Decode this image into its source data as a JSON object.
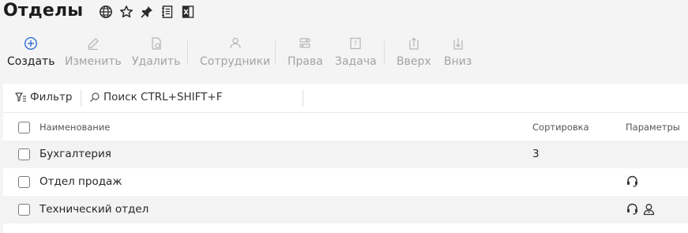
{
  "page": {
    "title": "Отделы",
    "title_icons": [
      "globe-icon",
      "star-icon",
      "pin-icon",
      "notebook-icon",
      "excel-icon"
    ]
  },
  "toolbar": {
    "buttons": [
      {
        "label": "Создать",
        "icon": "plus-circle-icon",
        "enabled": true
      },
      {
        "label": "Изменить",
        "icon": "pencil-icon",
        "enabled": false
      },
      {
        "label": "Удалить",
        "icon": "delete-doc-icon",
        "enabled": false
      },
      {
        "label": "Сотрудники",
        "icon": "employees-icon",
        "enabled": false
      },
      {
        "label": "Права",
        "icon": "rights-icon",
        "enabled": false
      },
      {
        "label": "Задача",
        "icon": "task-icon",
        "enabled": false
      },
      {
        "label": "Вверх",
        "icon": "move-up-icon",
        "enabled": false
      },
      {
        "label": "Вниз",
        "icon": "move-down-icon",
        "enabled": false
      }
    ]
  },
  "filter": {
    "filter_label": "Фильтр",
    "search_placeholder": "Поиск CTRL+SHIFT+F"
  },
  "table": {
    "columns": {
      "name": "Наименование",
      "sort": "Сортировка",
      "params": "Параметры"
    },
    "rows": [
      {
        "name": "Бухгалтерия",
        "sort": "3",
        "params": []
      },
      {
        "name": "Отдел продаж",
        "sort": "",
        "params": [
          "headset-icon"
        ]
      },
      {
        "name": "Технический отдел",
        "sort": "",
        "params": [
          "headset-icon",
          "user-badge-icon"
        ]
      }
    ]
  },
  "colors": {
    "accent": "#2f6fd3",
    "disabled": "#a3a3a3",
    "background": "#f4f4f5",
    "row_shade": "#f3f3f3"
  }
}
